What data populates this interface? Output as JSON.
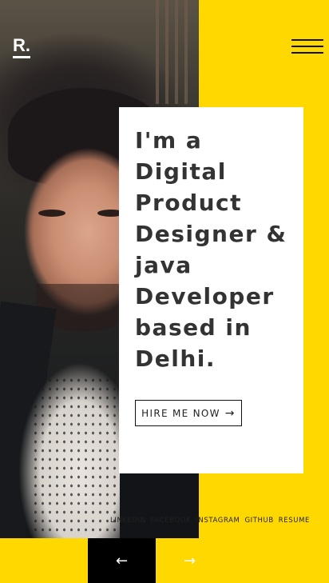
{
  "logo": {
    "text": "R."
  },
  "hero": {
    "headline": "I'm a Digital Product Designer & java Developer based in Delhi.",
    "cta_label": "HIRE ME NOW",
    "cta_icon": "arrow-right-icon"
  },
  "social_links": [
    "LINKEDIN",
    "FACEBOOK",
    "INSTAGRAM",
    "GITHUB",
    "RESUME"
  ],
  "slider_nav": {
    "prev_icon": "arrow-left-icon",
    "next_icon": "arrow-right-icon",
    "prev_glyph": "←",
    "next_glyph": "→"
  },
  "colors": {
    "accent_yellow": "#ffd800",
    "card_bg": "#ffffff",
    "text_dark": "#333333",
    "nav_dark": "#000000"
  }
}
